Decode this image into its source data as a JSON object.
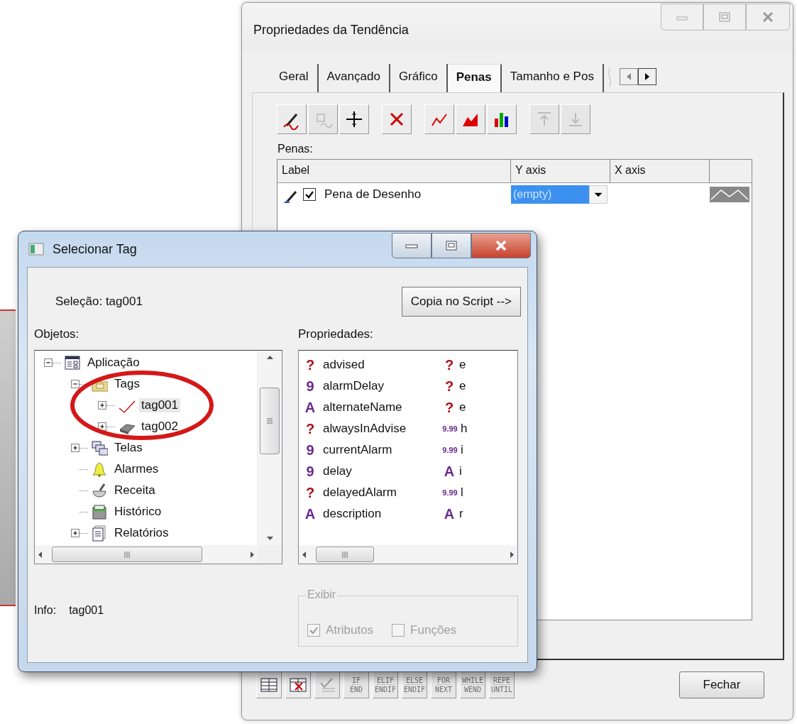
{
  "main_window": {
    "title": "Propriedades da Tendência",
    "tabs": [
      {
        "label": "Geral",
        "selected": false
      },
      {
        "label": "Avançado",
        "selected": false
      },
      {
        "label": "Gráfico",
        "selected": false
      },
      {
        "label": "Penas",
        "selected": true
      },
      {
        "label": "Tamanho e Pos",
        "selected": false
      }
    ],
    "toolbar": [
      {
        "buttons": [
          {
            "kind": "pen",
            "disabled": false
          },
          {
            "kind": "pen-edit",
            "disabled": true
          },
          {
            "kind": "cursor",
            "disabled": false
          }
        ]
      },
      {
        "buttons": [
          {
            "kind": "delete",
            "disabled": false
          }
        ]
      },
      {
        "buttons": [
          {
            "kind": "line",
            "disabled": false
          },
          {
            "kind": "area",
            "disabled": false
          },
          {
            "kind": "bars",
            "disabled": false
          }
        ]
      },
      {
        "buttons": [
          {
            "kind": "up",
            "disabled": true
          },
          {
            "kind": "down",
            "disabled": true
          }
        ]
      }
    ],
    "pens_label": "Penas:",
    "table": {
      "columns": [
        "Label",
        "Y axis",
        "X axis"
      ],
      "rows": [
        {
          "label": "Pena de Desenho",
          "checked": true,
          "y_axis": "(empty)",
          "y_axis_selected": true
        }
      ]
    },
    "bottom_toolbar": [
      {
        "buttons": [
          {
            "kind": "grid",
            "disabled": false
          },
          {
            "kind": "grid-delete",
            "disabled": false
          }
        ]
      },
      {
        "buttons": [
          {
            "kind": "check",
            "disabled": true
          }
        ]
      },
      {
        "buttons": [
          {
            "kind": "text",
            "lines": [
              "IF",
              "END"
            ],
            "disabled": true
          },
          {
            "kind": "text",
            "lines": [
              "ELIF",
              "ENDIF"
            ],
            "disabled": true
          },
          {
            "kind": "text",
            "lines": [
              "ELSE",
              "ENDIF"
            ],
            "disabled": true
          },
          {
            "kind": "text",
            "lines": [
              "FOR",
              "NEXT"
            ],
            "disabled": true
          },
          {
            "kind": "text",
            "lines": [
              "WHILE",
              "WEND"
            ],
            "disabled": true
          },
          {
            "kind": "text",
            "lines": [
              "REPE",
              "UNTIL"
            ],
            "disabled": true
          }
        ]
      }
    ],
    "close_button": "Fechar"
  },
  "dialog": {
    "title": "Selecionar Tag",
    "selection": "Seleção: tag001",
    "copy_button": "Copia no Script -->",
    "objects_label": "Objetos:",
    "properties_label": "Propriedades:",
    "tree": [
      {
        "label": "Aplicação",
        "kind": "app",
        "expanded": true,
        "selected": false,
        "children": [
          {
            "label": "Tags",
            "kind": "folder",
            "expanded": true,
            "selected": false,
            "children": [
              {
                "label": "tag001",
                "kind": "trend",
                "expanded": false,
                "selected": true
              },
              {
                "label": "tag002",
                "kind": "tag",
                "expanded": false,
                "selected": false
              }
            ]
          },
          {
            "label": "Telas",
            "kind": "screens",
            "expanded": false,
            "selected": false
          },
          {
            "label": "Alarmes",
            "kind": "bell",
            "selected": false
          },
          {
            "label": "Receita",
            "kind": "recipe",
            "selected": false
          },
          {
            "label": "Histórico",
            "kind": "history",
            "selected": false
          },
          {
            "label": "Relatórios",
            "kind": "report",
            "expanded": false,
            "selected": false
          }
        ]
      }
    ],
    "properties": [
      {
        "kind": "bool",
        "glyph": "?",
        "name": "advised",
        "value": {
          "kind": "bool",
          "glyph": "?",
          "text": "e"
        }
      },
      {
        "kind": "int",
        "glyph": "9",
        "name": "alarmDelay",
        "value": {
          "kind": "bool",
          "glyph": "?",
          "text": "e"
        }
      },
      {
        "kind": "string",
        "glyph": "A",
        "name": "alternateName",
        "value": {
          "kind": "bool",
          "glyph": "?",
          "text": "e"
        }
      },
      {
        "kind": "bool",
        "glyph": "?",
        "name": "alwaysInAdvise",
        "value": {
          "kind": "real",
          "glyph": "9.99",
          "text": "h"
        }
      },
      {
        "kind": "int",
        "glyph": "9",
        "name": "currentAlarm",
        "value": {
          "kind": "real",
          "glyph": "9.99",
          "text": "i"
        }
      },
      {
        "kind": "int",
        "glyph": "9",
        "name": "delay",
        "value": {
          "kind": "string",
          "glyph": "A",
          "text": "i"
        }
      },
      {
        "kind": "bool",
        "glyph": "?",
        "name": "delayedAlarm",
        "value": {
          "kind": "real",
          "glyph": "9.99",
          "text": "l"
        }
      },
      {
        "kind": "string",
        "glyph": "A",
        "name": "description",
        "value": {
          "kind": "string",
          "glyph": "A",
          "text": "r"
        }
      }
    ],
    "info_label": "Info:",
    "info_value": "tag001",
    "display_group": {
      "title": "Exibir",
      "options": [
        {
          "label": "Atributos",
          "checked": true,
          "disabled": true
        },
        {
          "label": "Funções",
          "checked": false,
          "disabled": true
        }
      ]
    }
  }
}
